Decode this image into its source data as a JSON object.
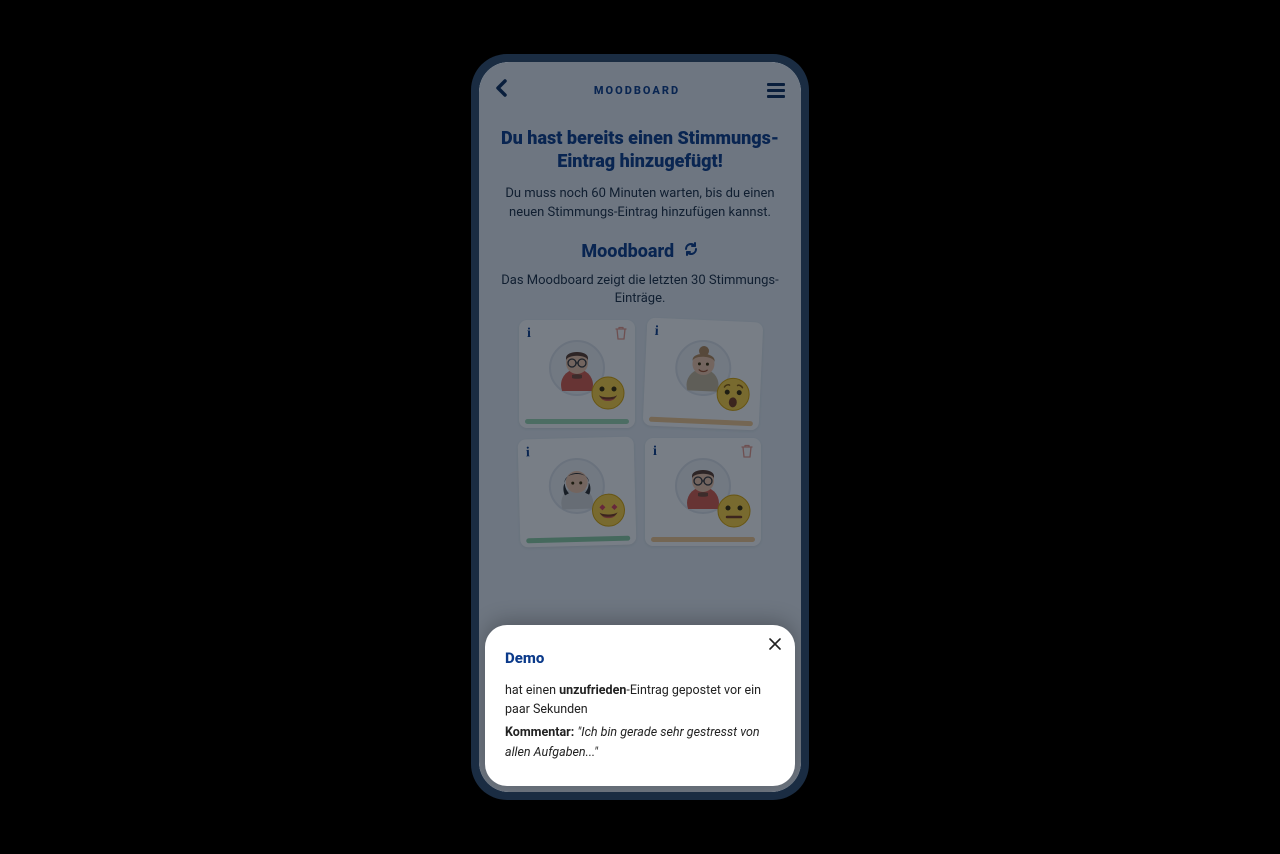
{
  "topbar": {
    "title": "MOODBOARD"
  },
  "headline": "Du hast bereits einen Stimmungs-Eintrag hinzugefügt!",
  "subtext": "Du muss noch 60 Minuten warten, bis du einen neuen Stimmungs-Eintrag hinzufügen kannst.",
  "moodboard": {
    "title": "Moodboard",
    "subtitle": "Das Moodboard zeigt die letzten 30 Stimmungs-Einträge."
  },
  "cards": [
    {
      "info": "i",
      "has_trash": true,
      "bar_color": "green",
      "mood": "happy",
      "avatar": "man-glasses-red"
    },
    {
      "info": "i",
      "has_trash": false,
      "bar_color": "orange",
      "mood": "sad",
      "avatar": "woman-bun"
    },
    {
      "info": "i",
      "has_trash": false,
      "bar_color": "dkgreen",
      "mood": "excited",
      "avatar": "woman-dark"
    },
    {
      "info": "i",
      "has_trash": true,
      "bar_color": "orange",
      "mood": "neutral",
      "avatar": "man-glasses-red2"
    }
  ],
  "popup": {
    "title": "Demo",
    "line1_prefix": "hat einen ",
    "line1_bold": "unzufrieden",
    "line1_suffix": "-Eintrag gepostet vor ein paar Se­kunden",
    "comment_label": "Kommentar:",
    "comment_text": "\"Ich bin gerade sehr gestresst von allen Aufgaben...\""
  }
}
